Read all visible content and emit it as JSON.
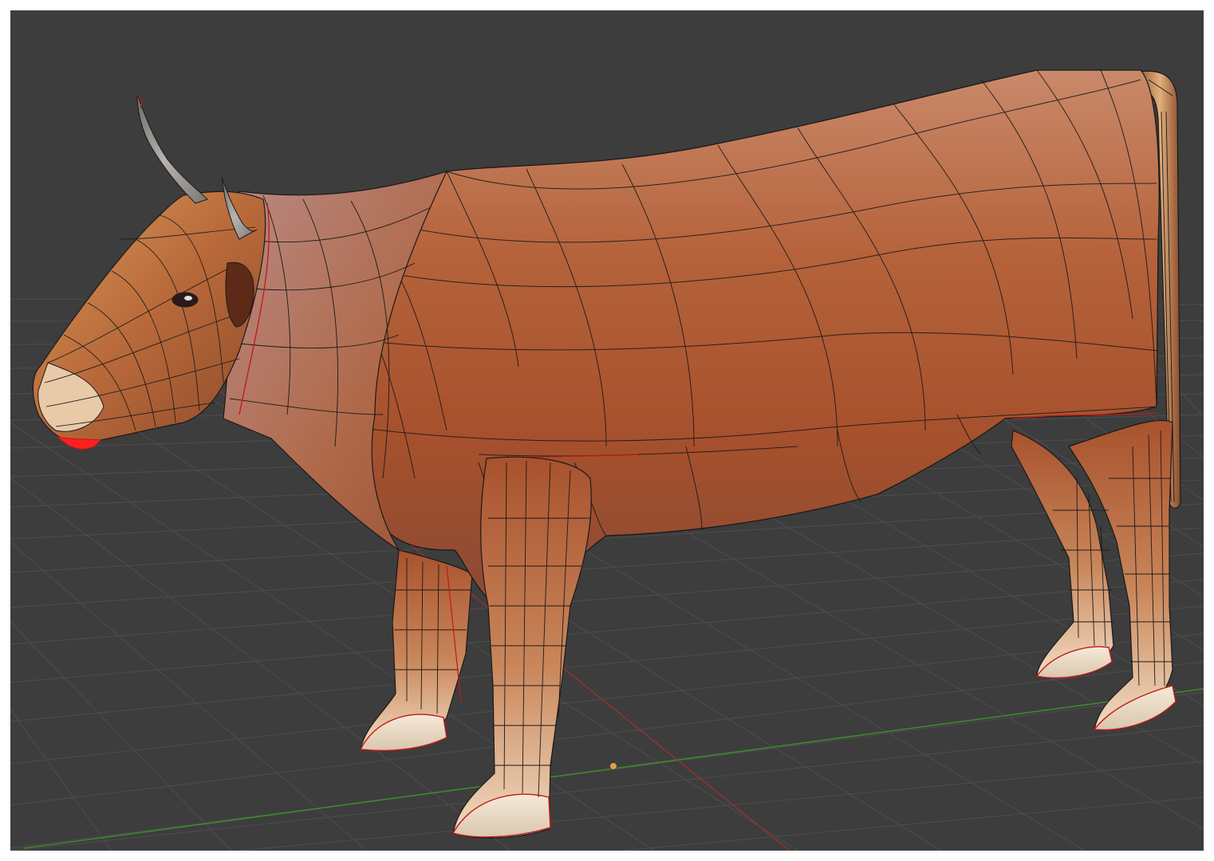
{
  "viewport": {
    "mode": "3d-view",
    "background_color": "#3d3d3d",
    "grid_color": "#4a4a4a",
    "x_axis_color": "#9b3030",
    "y_axis_color": "#3c8a2c",
    "object": "cow-mesh",
    "shading": "textured",
    "wireframe_overlay": true,
    "seam_color": "#ff2020",
    "origin_marker_color": "#d9a24a"
  }
}
